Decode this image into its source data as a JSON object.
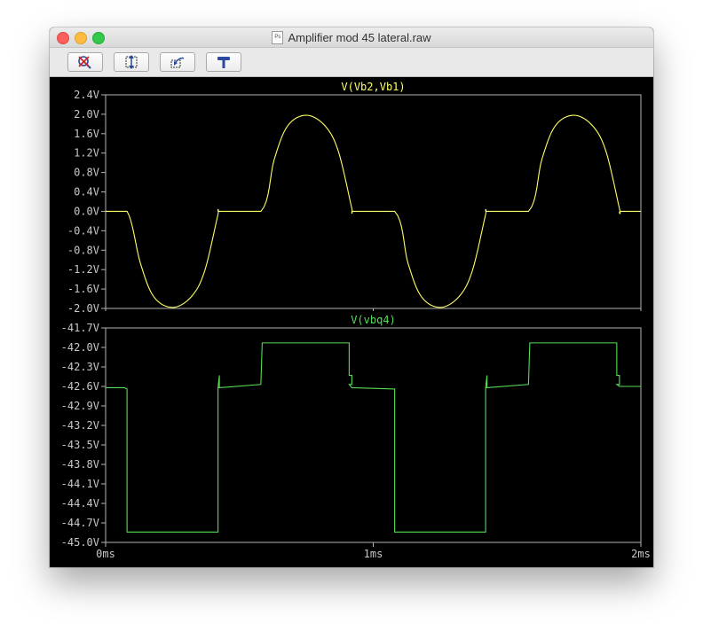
{
  "window": {
    "title": "Amplifier mod 45 lateral.raw",
    "doc_icon_text": "Ps"
  },
  "toolbar": {
    "buttons": [
      {
        "icon": "zoom-cancel-icon"
      },
      {
        "icon": "autoscale-icon"
      },
      {
        "icon": "zoom-back-icon"
      },
      {
        "icon": "hammer-icon"
      }
    ]
  },
  "colors": {
    "trace1": "#ffff66",
    "trace2": "#55dd55",
    "axes": "#b4b4b4",
    "labels": "#c8c8c8",
    "background": "#000000"
  },
  "chart_data": [
    {
      "type": "line",
      "title": "V(Vb2,Vb1)",
      "title_color": "#ffff66",
      "ylabel": "",
      "xlabel": "",
      "ylim": [
        -2.0,
        2.4
      ],
      "yticks": [
        "2.4V",
        "2.0V",
        "1.6V",
        "1.2V",
        "0.8V",
        "0.4V",
        "0.0V",
        "-0.4V",
        "-0.8V",
        "-1.2V",
        "-1.6V",
        "-2.0V"
      ],
      "ytick_values": [
        2.4,
        2.0,
        1.6,
        1.2,
        0.8,
        0.4,
        0.0,
        -0.4,
        -0.8,
        -1.2,
        -1.6,
        -2.0
      ],
      "xlim": [
        0,
        2
      ],
      "x_unit": "ms",
      "grid": false,
      "series": [
        {
          "color": "#ffff66",
          "x": [
            0.0,
            0.08,
            0.13,
            0.18,
            0.25,
            0.32,
            0.37,
            0.42,
            0.425,
            0.58,
            0.63,
            0.68,
            0.75,
            0.82,
            0.87,
            0.92,
            0.925,
            1.08,
            1.13,
            1.18,
            1.25,
            1.32,
            1.37,
            1.42,
            1.425,
            1.58,
            1.63,
            1.68,
            1.75,
            1.82,
            1.87,
            1.92,
            1.925,
            2.0
          ],
          "y": [
            0.0,
            0.0,
            -1.07,
            -1.76,
            -1.98,
            -1.76,
            -1.23,
            -0.06,
            0.0,
            0.0,
            1.07,
            1.76,
            1.98,
            1.76,
            1.23,
            0.06,
            0.0,
            0.0,
            -1.07,
            -1.76,
            -1.98,
            -1.76,
            -1.23,
            -0.06,
            0.0,
            0.0,
            1.07,
            1.76,
            1.98,
            1.76,
            1.23,
            0.06,
            0.0,
            0.0
          ]
        }
      ]
    },
    {
      "type": "line",
      "title": "V(vbq4)",
      "title_color": "#55dd55",
      "ylabel": "",
      "xlabel": "",
      "ylim": [
        -45.0,
        -41.7
      ],
      "yticks": [
        "-41.7V",
        "-42.0V",
        "-42.3V",
        "-42.6V",
        "-42.9V",
        "-43.2V",
        "-43.5V",
        "-43.8V",
        "-44.1V",
        "-44.4V",
        "-44.7V",
        "-45.0V"
      ],
      "ytick_values": [
        -41.7,
        -42.0,
        -42.3,
        -42.6,
        -42.9,
        -43.2,
        -43.5,
        -43.8,
        -44.1,
        -44.4,
        -44.7,
        -45.0
      ],
      "xlim": [
        0,
        2
      ],
      "x_unit": "ms",
      "xticks": [
        "0ms",
        "1ms",
        "2ms"
      ],
      "xtick_values": [
        0,
        1,
        2
      ],
      "grid": false,
      "series": [
        {
          "color": "#55dd55",
          "x": [
            0.0,
            0.07,
            0.08,
            0.08,
            0.42,
            0.42,
            0.425,
            0.425,
            0.42,
            0.425,
            0.58,
            0.58,
            0.585,
            0.585,
            0.91,
            0.91,
            0.92,
            0.92,
            0.91,
            0.92,
            1.08,
            1.08,
            1.42,
            1.42,
            1.425,
            1.425,
            1.42,
            1.425,
            1.58,
            1.58,
            1.585,
            1.585,
            1.91,
            1.91,
            1.92,
            1.92,
            1.91,
            1.92,
            2.0
          ],
          "y": [
            -42.62,
            -42.62,
            -42.64,
            -44.84,
            -44.84,
            -42.62,
            -42.62,
            -42.43,
            -42.62,
            -42.62,
            -42.57,
            -42.57,
            -41.93,
            -41.93,
            -41.93,
            -42.43,
            -42.43,
            -42.57,
            -42.57,
            -42.62,
            -42.64,
            -44.84,
            -44.84,
            -42.62,
            -42.62,
            -42.43,
            -42.62,
            -42.62,
            -42.57,
            -42.57,
            -41.93,
            -41.93,
            -41.93,
            -42.43,
            -42.43,
            -42.57,
            -42.57,
            -42.6,
            -42.6
          ]
        }
      ]
    }
  ]
}
